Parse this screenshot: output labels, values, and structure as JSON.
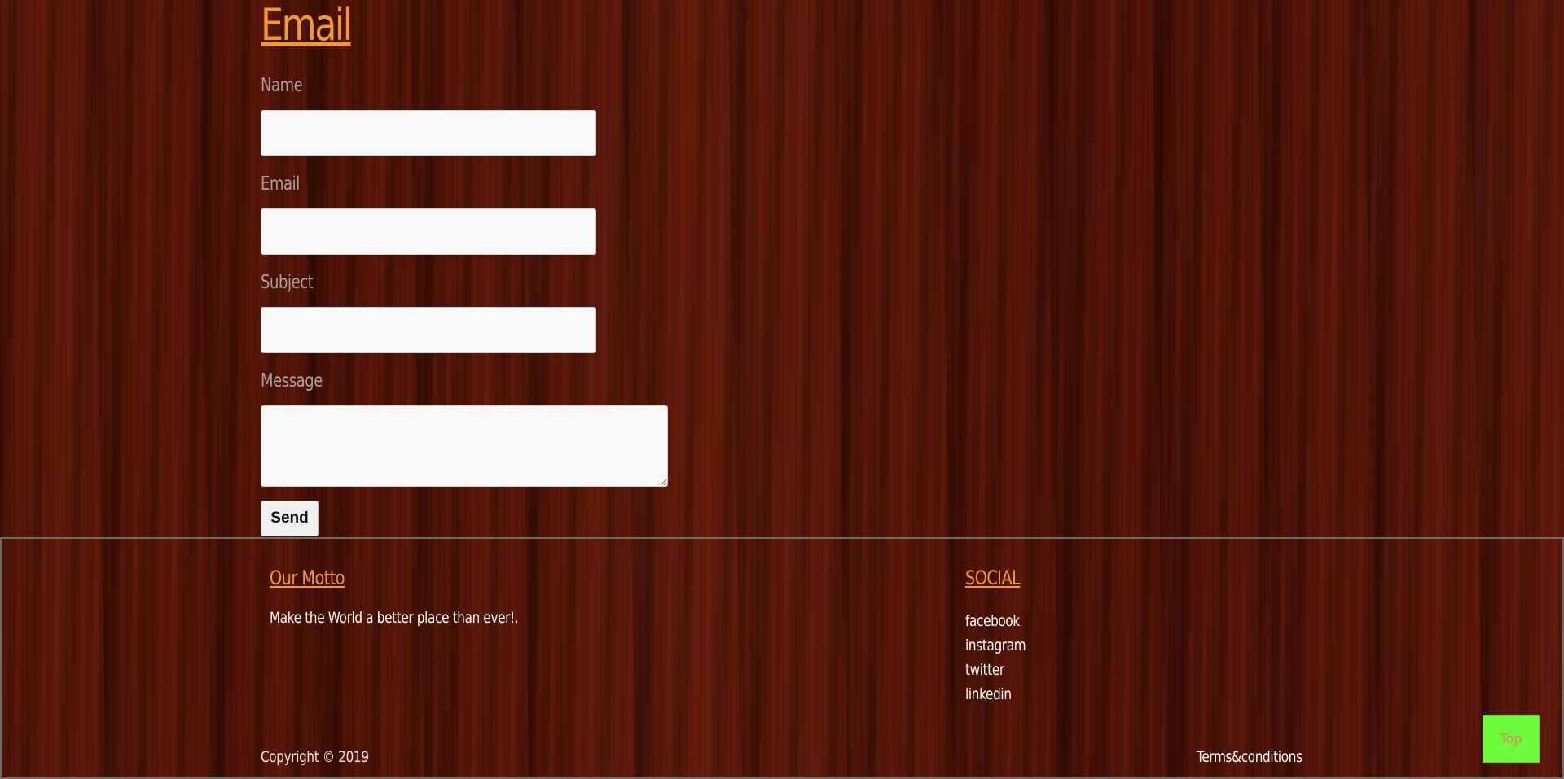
{
  "contact": {
    "title": "Email",
    "fields": {
      "name_label": "Name",
      "email_label": "Email",
      "subject_label": "Subject",
      "message_label": "Message",
      "name_value": "",
      "email_value": "",
      "subject_value": "",
      "message_value": ""
    },
    "send_label": "Send"
  },
  "footer": {
    "motto_title": "Our Motto",
    "motto_text": "Make the World a better place than ever!.",
    "social_title": "SOCIAL",
    "social_links": [
      "facebook",
      "instagram",
      "twitter",
      "linkedin"
    ],
    "copyright": "Copyright © 2019",
    "terms": "Terms&conditions"
  },
  "top_button": "Top",
  "colors": {
    "accent": "#f39a2a",
    "top_button_bg": "#6cfc39",
    "label_gray": "#a9a19c"
  }
}
